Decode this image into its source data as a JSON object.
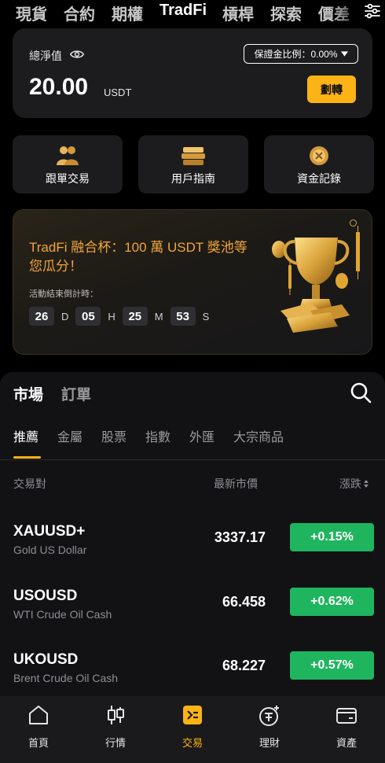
{
  "top_tabs": [
    {
      "label": "現貨",
      "active": false
    },
    {
      "label": "合約",
      "active": false
    },
    {
      "label": "期權",
      "active": false
    },
    {
      "label": "TradFi",
      "active": true
    },
    {
      "label": "槓桿",
      "active": false
    },
    {
      "label": "探索",
      "active": false
    },
    {
      "label": "價差",
      "active": false
    }
  ],
  "account": {
    "label": "總淨值",
    "amount": "20.00",
    "unit": "USDT",
    "margin_ratio": "保證金比例：0.00%",
    "transfer_label": "劃轉"
  },
  "quick_actions": [
    {
      "label": "跟單交易",
      "icon": "copy-trade-icon"
    },
    {
      "label": "用戶指南",
      "icon": "guide-icon"
    },
    {
      "label": "資金記錄",
      "icon": "funds-record-icon"
    }
  ],
  "promo": {
    "title": "TradFi 融合杯：100 萬 USDT 獎池等您瓜分！",
    "countdown_label": "活動結束倒計時：",
    "countdown": [
      {
        "value": "26",
        "unit": "D"
      },
      {
        "value": "05",
        "unit": "H"
      },
      {
        "value": "25",
        "unit": "M"
      },
      {
        "value": "53",
        "unit": "S"
      }
    ]
  },
  "market": {
    "tabs": [
      {
        "label": "市場",
        "active": true
      },
      {
        "label": "訂單",
        "active": false
      }
    ],
    "categories": [
      {
        "label": "推薦",
        "active": true
      },
      {
        "label": "金屬",
        "active": false
      },
      {
        "label": "股票",
        "active": false
      },
      {
        "label": "指數",
        "active": false
      },
      {
        "label": "外匯",
        "active": false
      },
      {
        "label": "大宗商品",
        "active": false
      }
    ],
    "headers": {
      "pair": "交易對",
      "price": "最新市價",
      "change": "漲跌"
    },
    "rows": [
      {
        "symbol": "XAUUSD+",
        "description": "Gold US Dollar",
        "price": "3337.17",
        "change": "+0.15%"
      },
      {
        "symbol": "USOUSD",
        "description": "WTI Crude Oil Cash",
        "price": "66.458",
        "change": "+0.62%"
      },
      {
        "symbol": "UKOUSD",
        "description": "Brent Crude Oil Cash",
        "price": "68.227",
        "change": "+0.57%"
      }
    ]
  },
  "bottom_nav": [
    {
      "label": "首頁",
      "icon": "home-icon",
      "active": false
    },
    {
      "label": "行情",
      "icon": "candlestick-icon",
      "active": false
    },
    {
      "label": "交易",
      "icon": "trade-icon",
      "active": true
    },
    {
      "label": "理財",
      "icon": "earn-icon",
      "active": false
    },
    {
      "label": "資產",
      "icon": "wallet-icon",
      "active": false
    }
  ],
  "colors": {
    "accent": "#fcb316",
    "up": "#1fb55e",
    "card": "#1c1c1e",
    "promo_text": "#f0a43a"
  }
}
